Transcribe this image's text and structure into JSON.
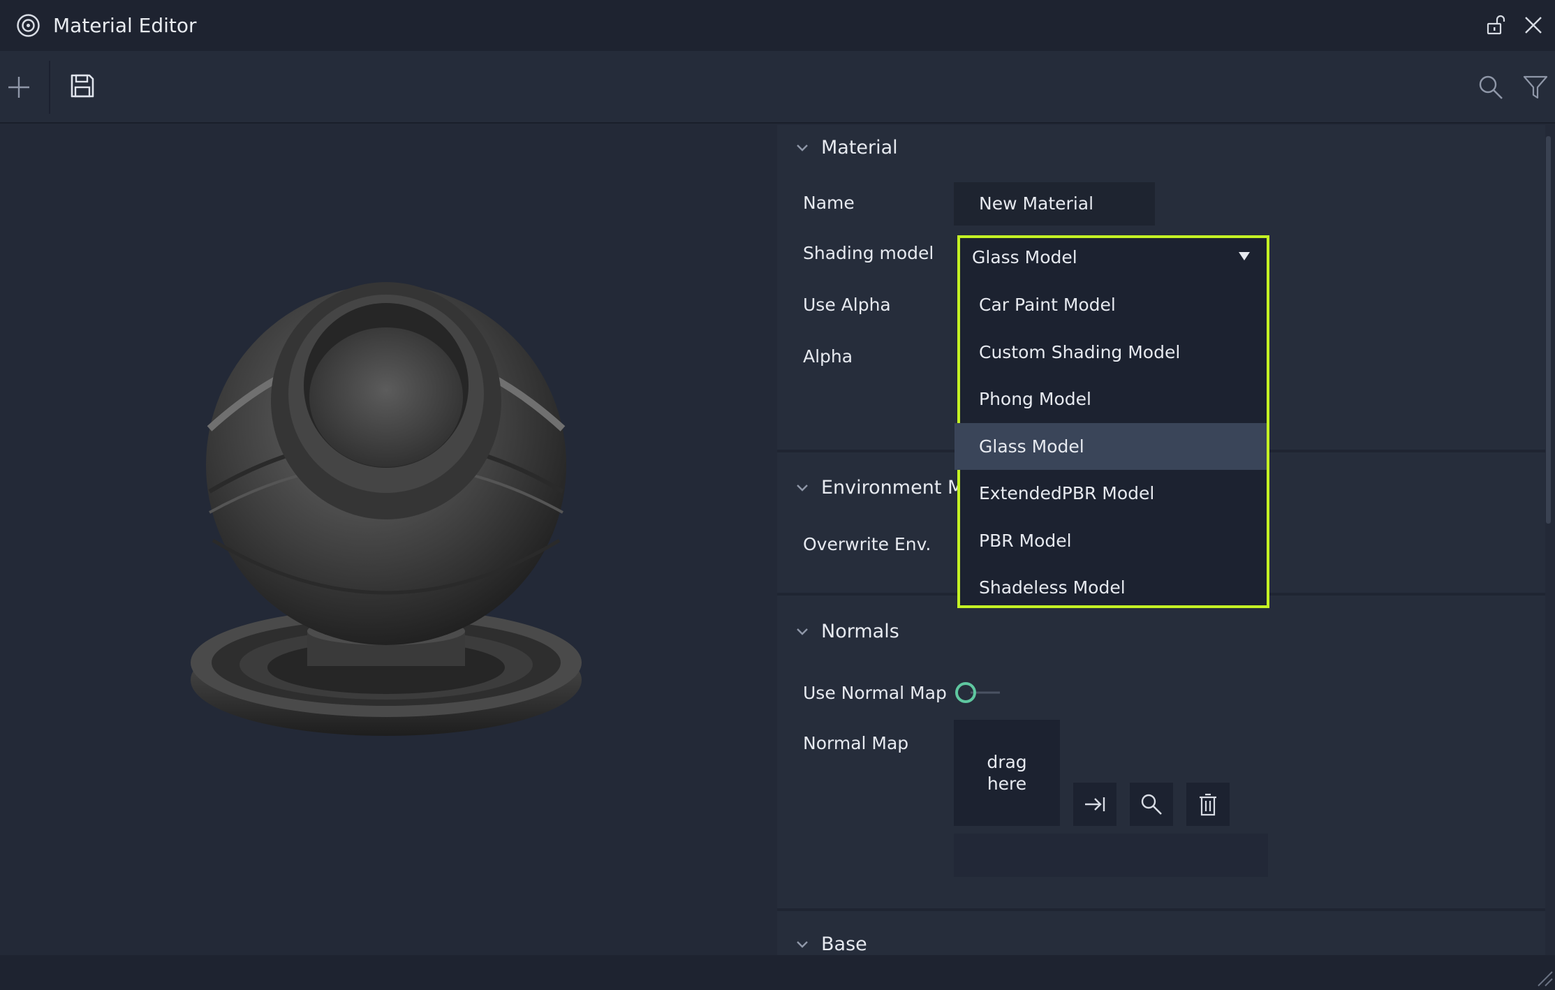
{
  "window": {
    "title": "Material Editor",
    "icons": {
      "logo": "app-logo-icon",
      "lock": "unlock-icon",
      "close": "close-icon"
    }
  },
  "toolbar": {
    "icons": {
      "add": "plus-icon",
      "save": "save-icon",
      "search": "search-icon",
      "filter": "filter-icon"
    }
  },
  "sections": {
    "material": {
      "title": "Material",
      "name_label": "Name",
      "name_value": "New Material",
      "shading_label": "Shading model",
      "use_alpha_label": "Use Alpha",
      "alpha_label": "Alpha"
    },
    "environment": {
      "title": "Environment Ma",
      "overwrite_label": "Overwrite Env."
    },
    "normals": {
      "title": "Normals",
      "use_normal_map_label": "Use Normal Map",
      "use_normal_map_on": false,
      "normal_map_label": "Normal Map",
      "drop_line1": "drag",
      "drop_line2": "here",
      "icons": {
        "apply": "arrow-to-right-icon",
        "browse": "search-icon",
        "delete": "trash-icon"
      }
    },
    "base": {
      "title": "Base"
    }
  },
  "shading_dropdown": {
    "selected": "Glass Model",
    "options": [
      "Car Paint Model",
      "Custom Shading Model",
      "Phong Model",
      "Glass Model",
      "ExtendedPBR Model",
      "PBR Model",
      "Shadeless Model"
    ],
    "highlight_color": "#c4f124"
  },
  "colors": {
    "accent": "#c4f124",
    "toggle": "#5fc7a0",
    "background": "#232937"
  }
}
